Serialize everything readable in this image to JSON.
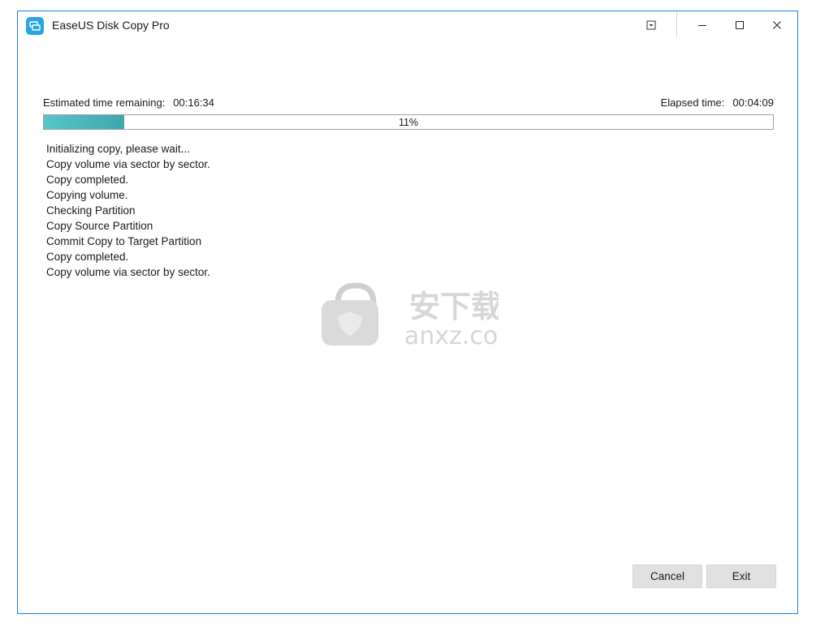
{
  "window": {
    "title": "EaseUS Disk Copy Pro"
  },
  "progress": {
    "estimated_label": "Estimated time remaining:",
    "estimated_value": "00:16:34",
    "elapsed_label": "Elapsed time:",
    "elapsed_value": "00:04:09",
    "percent_text": "11%",
    "fraction": 0.11,
    "fill_color": "#4bb8bb"
  },
  "log": [
    "Initializing copy, please wait...",
    "Copy volume via sector by sector.",
    "Copy completed.",
    "Copying volume.",
    "Checking Partition",
    "Copy Source Partition",
    "Commit Copy to Target Partition",
    "Copy completed.",
    "Copy volume via sector by sector."
  ],
  "watermark": {
    "cn": "安下载",
    "en": "anxz.com"
  },
  "buttons": {
    "cancel": "Cancel",
    "exit": "Exit"
  },
  "colors": {
    "accent": "#25a6e0",
    "border": "#1f7fd6",
    "button_bg": "#e1e1e1"
  }
}
